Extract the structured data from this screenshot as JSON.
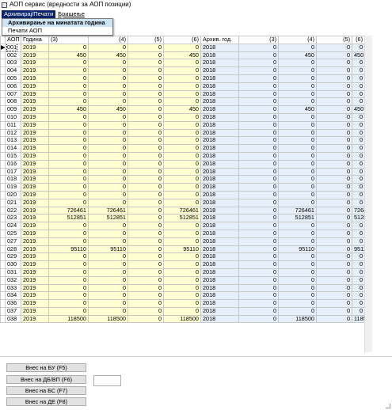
{
  "window": {
    "title": "АОП сервис (вредности за АОП позиции)"
  },
  "menu": {
    "items": [
      {
        "label": "Архивирај/Печати"
      },
      {
        "label": "Бришење"
      }
    ],
    "dropdown": [
      {
        "label": "Архивирање на минатата година"
      },
      {
        "label": "Печати АОП"
      }
    ]
  },
  "grid": {
    "columns": [
      "АОП",
      "Година",
      "(3)",
      "(4)",
      "(5)",
      "(6)",
      "Архив. год.",
      "(3)",
      "(4)",
      "(5)",
      "(6)"
    ],
    "rows": [
      {
        "aop": "001",
        "year": "2019",
        "c3": "0",
        "c4": "0",
        "c5": "0",
        "c6": "0",
        "ayear": "2018",
        "a3": "0",
        "a4": "0",
        "a5": "0",
        "a6": "0"
      },
      {
        "aop": "002",
        "year": "2019",
        "c3": "450",
        "c4": "450",
        "c5": "0",
        "c6": "450",
        "ayear": "2018",
        "a3": "0",
        "a4": "450",
        "a5": "0",
        "a6": "450"
      },
      {
        "aop": "003",
        "year": "2019",
        "c3": "0",
        "c4": "0",
        "c5": "0",
        "c6": "0",
        "ayear": "2018",
        "a3": "0",
        "a4": "0",
        "a5": "0",
        "a6": "0"
      },
      {
        "aop": "004",
        "year": "2019",
        "c3": "0",
        "c4": "0",
        "c5": "0",
        "c6": "0",
        "ayear": "2018",
        "a3": "0",
        "a4": "0",
        "a5": "0",
        "a6": "0"
      },
      {
        "aop": "005",
        "year": "2019",
        "c3": "0",
        "c4": "0",
        "c5": "0",
        "c6": "0",
        "ayear": "2018",
        "a3": "0",
        "a4": "0",
        "a5": "0",
        "a6": "0"
      },
      {
        "aop": "006",
        "year": "2019",
        "c3": "0",
        "c4": "0",
        "c5": "0",
        "c6": "0",
        "ayear": "2018",
        "a3": "0",
        "a4": "0",
        "a5": "0",
        "a6": "0"
      },
      {
        "aop": "007",
        "year": "2019",
        "c3": "0",
        "c4": "0",
        "c5": "0",
        "c6": "0",
        "ayear": "2018",
        "a3": "0",
        "a4": "0",
        "a5": "0",
        "a6": "0"
      },
      {
        "aop": "008",
        "year": "2019",
        "c3": "0",
        "c4": "0",
        "c5": "0",
        "c6": "0",
        "ayear": "2018",
        "a3": "0",
        "a4": "0",
        "a5": "0",
        "a6": "0"
      },
      {
        "aop": "009",
        "year": "2019",
        "c3": "450",
        "c4": "450",
        "c5": "0",
        "c6": "450",
        "ayear": "2018",
        "a3": "0",
        "a4": "450",
        "a5": "0",
        "a6": "450"
      },
      {
        "aop": "010",
        "year": "2019",
        "c3": "0",
        "c4": "0",
        "c5": "0",
        "c6": "0",
        "ayear": "2018",
        "a3": "0",
        "a4": "0",
        "a5": "0",
        "a6": "0"
      },
      {
        "aop": "011",
        "year": "2019",
        "c3": "0",
        "c4": "0",
        "c5": "0",
        "c6": "0",
        "ayear": "2018",
        "a3": "0",
        "a4": "0",
        "a5": "0",
        "a6": "0"
      },
      {
        "aop": "012",
        "year": "2019",
        "c3": "0",
        "c4": "0",
        "c5": "0",
        "c6": "0",
        "ayear": "2018",
        "a3": "0",
        "a4": "0",
        "a5": "0",
        "a6": "0"
      },
      {
        "aop": "013",
        "year": "2019",
        "c3": "0",
        "c4": "0",
        "c5": "0",
        "c6": "0",
        "ayear": "2018",
        "a3": "0",
        "a4": "0",
        "a5": "0",
        "a6": "0"
      },
      {
        "aop": "014",
        "year": "2019",
        "c3": "0",
        "c4": "0",
        "c5": "0",
        "c6": "0",
        "ayear": "2018",
        "a3": "0",
        "a4": "0",
        "a5": "0",
        "a6": "0"
      },
      {
        "aop": "015",
        "year": "2019",
        "c3": "0",
        "c4": "0",
        "c5": "0",
        "c6": "0",
        "ayear": "2018",
        "a3": "0",
        "a4": "0",
        "a5": "0",
        "a6": "0"
      },
      {
        "aop": "016",
        "year": "2019",
        "c3": "0",
        "c4": "0",
        "c5": "0",
        "c6": "0",
        "ayear": "2018",
        "a3": "0",
        "a4": "0",
        "a5": "0",
        "a6": "0"
      },
      {
        "aop": "017",
        "year": "2019",
        "c3": "0",
        "c4": "0",
        "c5": "0",
        "c6": "0",
        "ayear": "2018",
        "a3": "0",
        "a4": "0",
        "a5": "0",
        "a6": "0"
      },
      {
        "aop": "018",
        "year": "2019",
        "c3": "0",
        "c4": "0",
        "c5": "0",
        "c6": "0",
        "ayear": "2018",
        "a3": "0",
        "a4": "0",
        "a5": "0",
        "a6": "0"
      },
      {
        "aop": "019",
        "year": "2019",
        "c3": "0",
        "c4": "0",
        "c5": "0",
        "c6": "0",
        "ayear": "2018",
        "a3": "0",
        "a4": "0",
        "a5": "0",
        "a6": "0"
      },
      {
        "aop": "020",
        "year": "2019",
        "c3": "0",
        "c4": "0",
        "c5": "0",
        "c6": "0",
        "ayear": "2018",
        "a3": "0",
        "a4": "0",
        "a5": "0",
        "a6": "0"
      },
      {
        "aop": "021",
        "year": "2019",
        "c3": "0",
        "c4": "0",
        "c5": "0",
        "c6": "0",
        "ayear": "2018",
        "a3": "0",
        "a4": "0",
        "a5": "0",
        "a6": "0"
      },
      {
        "aop": "022",
        "year": "2019",
        "c3": "726461",
        "c4": "726461",
        "c5": "0",
        "c6": "726461",
        "ayear": "2018",
        "a3": "0",
        "a4": "726461",
        "a5": "0",
        "a6": "726461"
      },
      {
        "aop": "023",
        "year": "2019",
        "c3": "512851",
        "c4": "512851",
        "c5": "0",
        "c6": "512851",
        "ayear": "2018",
        "a3": "0",
        "a4": "512851",
        "a5": "0",
        "a6": "512851"
      },
      {
        "aop": "024",
        "year": "2019",
        "c3": "0",
        "c4": "0",
        "c5": "0",
        "c6": "0",
        "ayear": "2018",
        "a3": "0",
        "a4": "0",
        "a5": "0",
        "a6": "0"
      },
      {
        "aop": "025",
        "year": "2019",
        "c3": "0",
        "c4": "0",
        "c5": "0",
        "c6": "0",
        "ayear": "2018",
        "a3": "0",
        "a4": "0",
        "a5": "0",
        "a6": "0"
      },
      {
        "aop": "027",
        "year": "2019",
        "c3": "0",
        "c4": "0",
        "c5": "0",
        "c6": "0",
        "ayear": "2018",
        "a3": "0",
        "a4": "0",
        "a5": "0",
        "a6": "0"
      },
      {
        "aop": "028",
        "year": "2019",
        "c3": "95110",
        "c4": "95110",
        "c5": "0",
        "c6": "95110",
        "ayear": "2018",
        "a3": "0",
        "a4": "95110",
        "a5": "0",
        "a6": "95110"
      },
      {
        "aop": "029",
        "year": "2019",
        "c3": "0",
        "c4": "0",
        "c5": "0",
        "c6": "0",
        "ayear": "2018",
        "a3": "0",
        "a4": "0",
        "a5": "0",
        "a6": "0"
      },
      {
        "aop": "030",
        "year": "2019",
        "c3": "0",
        "c4": "0",
        "c5": "0",
        "c6": "0",
        "ayear": "2018",
        "a3": "0",
        "a4": "0",
        "a5": "0",
        "a6": "0"
      },
      {
        "aop": "031",
        "year": "2019",
        "c3": "0",
        "c4": "0",
        "c5": "0",
        "c6": "0",
        "ayear": "2018",
        "a3": "0",
        "a4": "0",
        "a5": "0",
        "a6": "0"
      },
      {
        "aop": "032",
        "year": "2019",
        "c3": "0",
        "c4": "0",
        "c5": "0",
        "c6": "0",
        "ayear": "2018",
        "a3": "0",
        "a4": "0",
        "a5": "0",
        "a6": "0"
      },
      {
        "aop": "033",
        "year": "2019",
        "c3": "0",
        "c4": "0",
        "c5": "0",
        "c6": "0",
        "ayear": "2018",
        "a3": "0",
        "a4": "0",
        "a5": "0",
        "a6": "0"
      },
      {
        "aop": "034",
        "year": "2019",
        "c3": "0",
        "c4": "0",
        "c5": "0",
        "c6": "0",
        "ayear": "2018",
        "a3": "0",
        "a4": "0",
        "a5": "0",
        "a6": "0"
      },
      {
        "aop": "036",
        "year": "2019",
        "c3": "0",
        "c4": "0",
        "c5": "0",
        "c6": "0",
        "ayear": "2018",
        "a3": "0",
        "a4": "0",
        "a5": "0",
        "a6": "0"
      },
      {
        "aop": "037",
        "year": "2019",
        "c3": "0",
        "c4": "0",
        "c5": "0",
        "c6": "0",
        "ayear": "2018",
        "a3": "0",
        "a4": "0",
        "a5": "0",
        "a6": "0"
      },
      {
        "aop": "038",
        "year": "2019",
        "c3": "118500",
        "c4": "118500",
        "c5": "0",
        "c6": "118500",
        "ayear": "2018",
        "a3": "0",
        "a4": "118500",
        "a5": "0",
        "a6": "118500"
      }
    ]
  },
  "buttons": [
    {
      "label": "Внес на БУ (F5)"
    },
    {
      "label": "Внес на ДБ/ВП (F6)"
    },
    {
      "label": "Внес на БС (F7)"
    },
    {
      "label": "Внес на ДЕ (F8)"
    }
  ],
  "colors": {
    "current_year_cells": "#ffffd2",
    "archive_cells": "#e6eef9",
    "menu_active": "#0a246a",
    "menu_highlight": "#cde4f7"
  }
}
